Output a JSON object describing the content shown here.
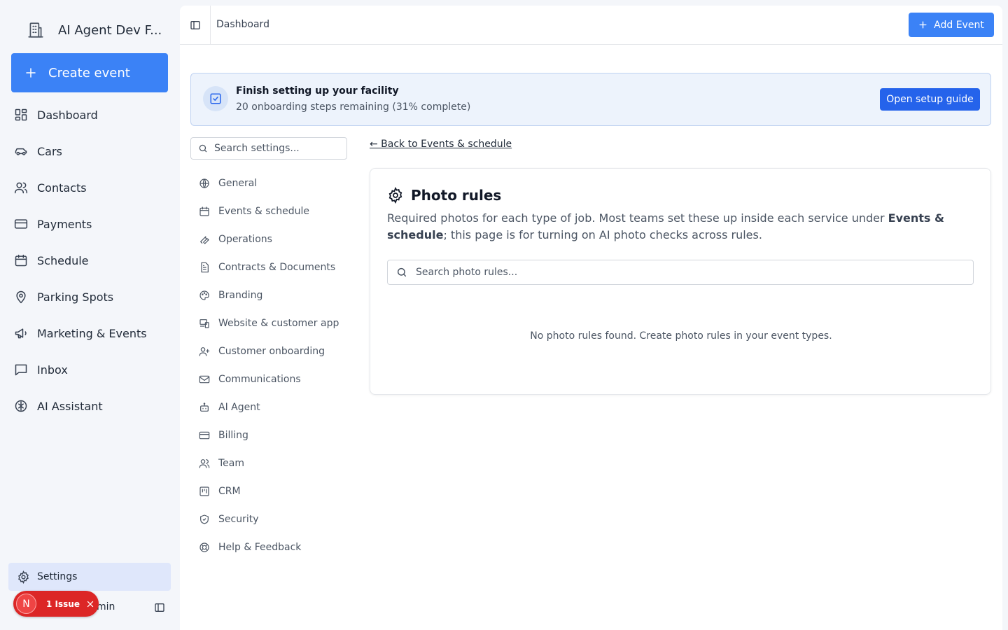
{
  "sidebar": {
    "brand_name": "AI Agent Dev F...",
    "create_label": "Create event",
    "items": [
      {
        "label": "Dashboard"
      },
      {
        "label": "Cars"
      },
      {
        "label": "Contacts"
      },
      {
        "label": "Payments"
      },
      {
        "label": "Schedule"
      },
      {
        "label": "Parking Spots"
      },
      {
        "label": "Marketing & Events"
      },
      {
        "label": "Inbox"
      },
      {
        "label": "AI Assistant"
      }
    ],
    "settings_label": "Settings",
    "user_name_visible": "min"
  },
  "issue_badge": {
    "avatar_letter": "N",
    "label": "1 Issue"
  },
  "header": {
    "breadcrumb": "Dashboard",
    "add_event_label": "Add Event"
  },
  "setup_banner": {
    "title": "Finish setting up your facility",
    "subtitle": "20 onboarding steps remaining (31% complete)",
    "button_label": "Open setup guide",
    "steps_remaining": 20,
    "percent_complete": 31
  },
  "settings_nav": {
    "search_placeholder": "Search settings...",
    "items": [
      {
        "label": "General"
      },
      {
        "label": "Events & schedule"
      },
      {
        "label": "Operations"
      },
      {
        "label": "Contracts & Documents"
      },
      {
        "label": "Branding"
      },
      {
        "label": "Website & customer app"
      },
      {
        "label": "Customer onboarding"
      },
      {
        "label": "Communications"
      },
      {
        "label": "AI Agent"
      },
      {
        "label": "Billing"
      },
      {
        "label": "Team"
      },
      {
        "label": "CRM"
      },
      {
        "label": "Security"
      },
      {
        "label": "Help & Feedback"
      }
    ]
  },
  "content": {
    "back_link": "← Back to Events & schedule",
    "card_title": "Photo rules",
    "desc_part1": "Required photos for each type of job. Most teams set these up inside each service under ",
    "desc_bold": "Events & schedule",
    "desc_part2": "; this page is for turning on AI photo checks across rules.",
    "search_placeholder": "Search photo rules...",
    "empty_message": "No photo rules found. Create photo rules in your event types."
  },
  "colors": {
    "accent": "#3b82f6",
    "setup_button": "#2563eb",
    "settings_active_bg": "#dfe7fb",
    "issue_red": "#dc2626"
  }
}
